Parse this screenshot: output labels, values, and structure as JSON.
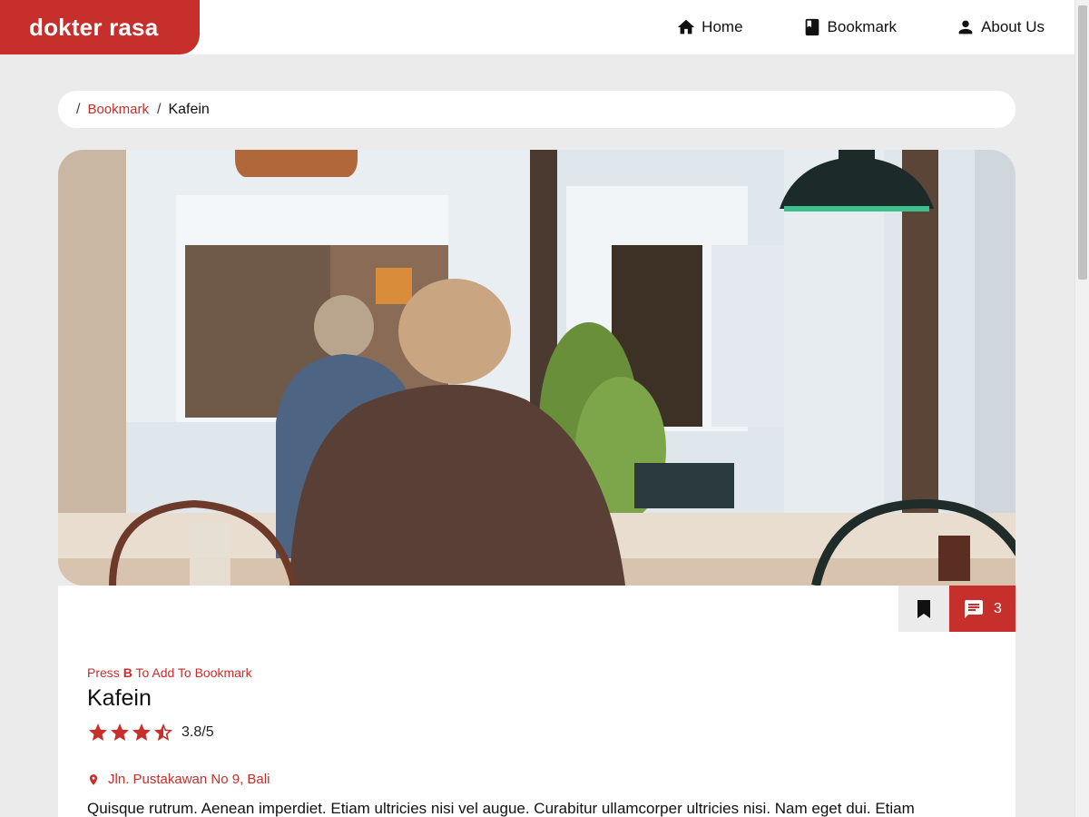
{
  "brand": {
    "name": "dokter rasa",
    "color": "#c62f2b"
  },
  "nav": [
    {
      "label": "Home",
      "icon": "home-icon"
    },
    {
      "label": "Bookmark",
      "icon": "book-icon"
    },
    {
      "label": "About Us",
      "icon": "person-icon"
    }
  ],
  "breadcrumb": {
    "separator": "/",
    "link": "Bookmark",
    "current": "Kafein"
  },
  "hero": {
    "image": "photo-cafe-interior-with-elderly-man"
  },
  "actions": {
    "bookmark_icon": "bookmark-icon",
    "comment_icon": "comment-icon",
    "comment_count": "3"
  },
  "detail": {
    "hint_prefix": "Press ",
    "hint_key": "B",
    "hint_suffix": " To Add To Bookmark",
    "name": "Kafein",
    "rating": 3.8,
    "rating_text": "3.8/5",
    "address": "Jln. Pustakawan No 9, Bali",
    "description": "Quisque rutrum. Aenean imperdiet. Etiam ultricies nisi vel augue. Curabitur ullamcorper ultricies nisi. Nam eget dui. Etiam"
  }
}
